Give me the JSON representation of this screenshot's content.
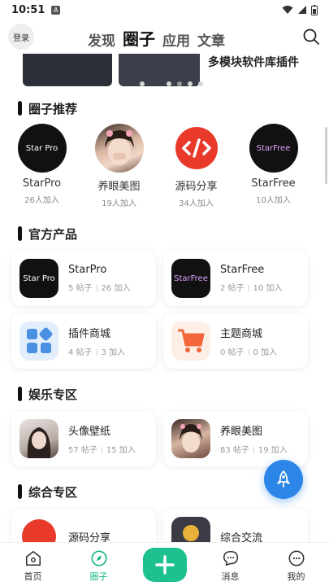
{
  "status_bar": {
    "time": "10:51",
    "notif_letter": "A"
  },
  "header": {
    "login_label": "登录",
    "tabs": [
      {
        "label": "发现",
        "active": false
      },
      {
        "label": "圈子",
        "active": true
      },
      {
        "label": "应用",
        "active": false
      },
      {
        "label": "文章",
        "active": false
      }
    ]
  },
  "banner": {
    "text": "多模块软件库插件"
  },
  "circle_recommend": {
    "title": "圈子推荐",
    "items": [
      {
        "name": "StarPro",
        "count": "26人加入",
        "logo": "Star Pro"
      },
      {
        "name": "养眼美图",
        "count": "19人加入",
        "logo": ""
      },
      {
        "name": "源码分享",
        "count": "34人加入",
        "logo": "code-icon"
      },
      {
        "name": "StarFree",
        "count": "10人加入",
        "logo": "StarFree"
      }
    ]
  },
  "official": {
    "title": "官方产品",
    "cards": [
      {
        "name": "StarPro",
        "posts": "5 帖子",
        "joins": "26 加入",
        "logo": "Star Pro"
      },
      {
        "name": "StarFree",
        "posts": "2 帖子",
        "joins": "10 加入",
        "logo": "StarFree"
      },
      {
        "name": "插件商城",
        "posts": "4 帖子",
        "joins": "3 加入",
        "logo": "grid-icon"
      },
      {
        "name": "主题商城",
        "posts": "0 帖子",
        "joins": "0 加入",
        "logo": "cart-icon"
      }
    ]
  },
  "entertainment": {
    "title": "娱乐专区",
    "cards": [
      {
        "name": "头像壁纸",
        "posts": "57 帖子",
        "joins": "15 加入"
      },
      {
        "name": "养眼美图",
        "posts": "83 帖子",
        "joins": "19 加入"
      }
    ]
  },
  "general": {
    "title": "综合专区",
    "cards": [
      {
        "name": "源码分享"
      },
      {
        "name": "综合交流"
      }
    ]
  },
  "bottom_nav": [
    {
      "label": "首页",
      "icon": "home-icon"
    },
    {
      "label": "圈子",
      "icon": "compass-icon",
      "active": true
    },
    {
      "label": "",
      "icon": "plus-icon"
    },
    {
      "label": "消息",
      "icon": "chat-icon"
    },
    {
      "label": "我的",
      "icon": "user-icon"
    }
  ],
  "colors": {
    "accent": "#1dc08f",
    "fab": "#2b86e8",
    "code_red": "#e8392b",
    "cart_orange": "#f2663a"
  }
}
